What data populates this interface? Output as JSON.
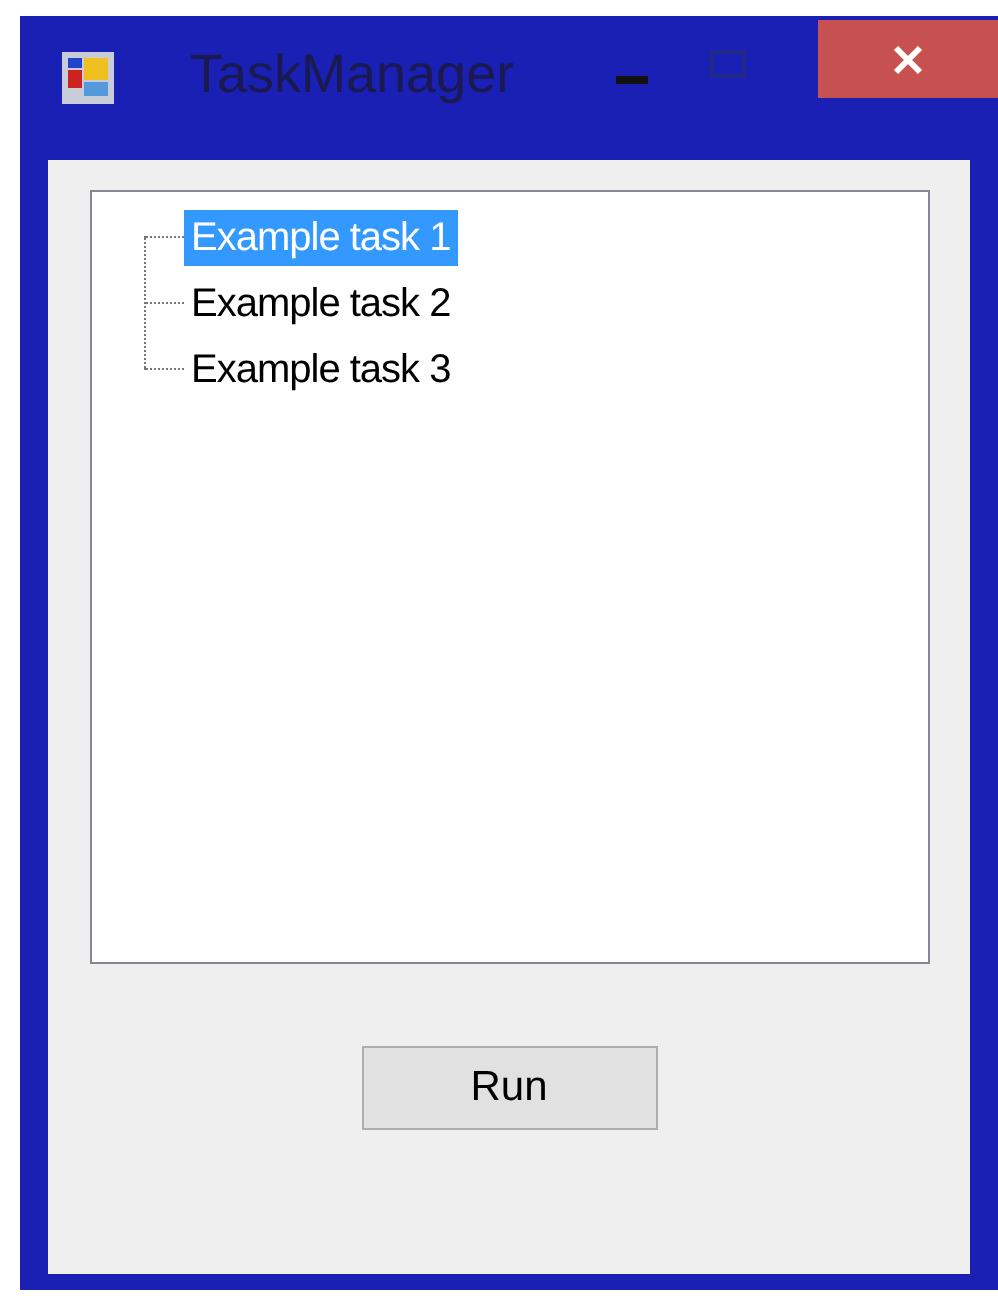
{
  "window": {
    "title": "TaskManager"
  },
  "tree": {
    "items": [
      {
        "label": "Example task 1",
        "selected": true
      },
      {
        "label": "Example task 2",
        "selected": false
      },
      {
        "label": "Example task 3",
        "selected": false
      }
    ]
  },
  "buttons": [
    {
      "label": "Run"
    }
  ]
}
